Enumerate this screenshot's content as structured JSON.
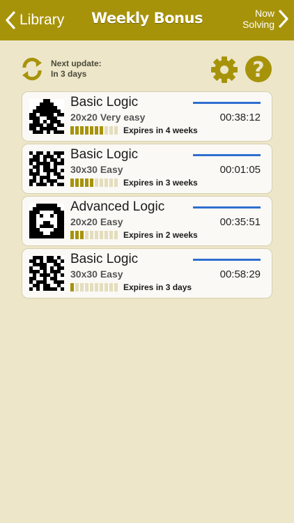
{
  "topbar": {
    "back_label": "Library",
    "title": "Weekly Bonus",
    "forward_label_line1": "Now",
    "forward_label_line2": "Solving"
  },
  "update": {
    "line1": "Next update:",
    "line2": "In 3 days"
  },
  "colors": {
    "accent": "#a7930a",
    "background": "#ede6c9",
    "progress": "#2f6fd0"
  },
  "icons": {
    "refresh": "refresh-icon",
    "settings": "gear-icon",
    "help": "help-icon"
  },
  "puzzles": [
    {
      "name": "Basic Logic",
      "size": "20x20 Very easy",
      "time": "00:38:12",
      "expires": "Expires in 4 weeks",
      "filled": 7,
      "total": 10
    },
    {
      "name": "Basic Logic",
      "size": "30x30 Easy",
      "time": "00:01:05",
      "expires": "Expires in 3 weeks",
      "filled": 5,
      "total": 10
    },
    {
      "name": "Advanced Logic",
      "size": "20x20 Easy",
      "time": "00:35:51",
      "expires": "Expires in 2 weeks",
      "filled": 3,
      "total": 10
    },
    {
      "name": "Basic Logic",
      "size": "30x30 Easy",
      "time": "00:58:29",
      "expires": "Expires in 3 days",
      "filled": 1,
      "total": 10
    }
  ]
}
